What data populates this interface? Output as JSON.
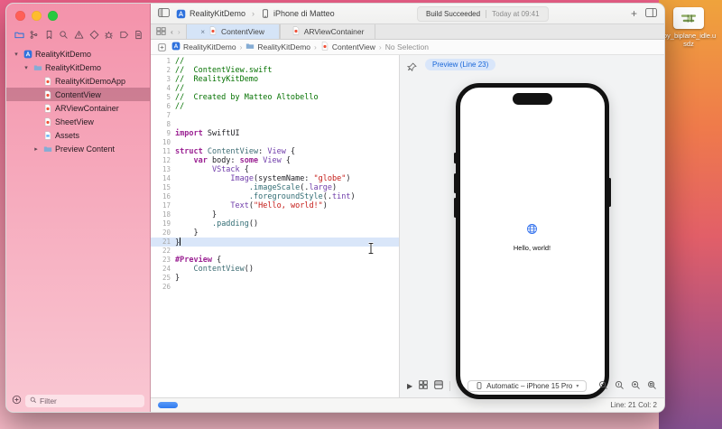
{
  "desktop": {
    "file_label": "toy_biplane_idle.usdz"
  },
  "colors": {
    "accent_blue": "#3478f6",
    "swift_orange": "#f05138",
    "string_red": "#c41a16",
    "keyword_pink": "#9b2393",
    "comment_green": "#047101",
    "type_purple": "#703daa"
  },
  "window": {
    "toolbar": {
      "project": "RealityKitDemo",
      "destination": "iPhone di Matteo",
      "status_title": "Build Succeeded",
      "status_time": "Today at 09:41"
    },
    "navigator": {
      "icons": [
        "project-navigator",
        "source-control",
        "bookmarks",
        "find",
        "issues",
        "tests",
        "debug",
        "breakpoints",
        "reports"
      ],
      "tree": [
        {
          "label": "RealityKitDemo",
          "type": "project",
          "level": 0,
          "disclosure": "open"
        },
        {
          "label": "RealityKitDemo",
          "type": "folder",
          "level": 1,
          "disclosure": "open"
        },
        {
          "label": "RealityKitDemoApp",
          "type": "swift",
          "level": 2
        },
        {
          "label": "ContentView",
          "type": "swift",
          "level": 2,
          "selected": true
        },
        {
          "label": "ARViewContainer",
          "type": "swift",
          "level": 2
        },
        {
          "label": "SheetView",
          "type": "swift",
          "level": 2
        },
        {
          "label": "Assets",
          "type": "assets",
          "level": 2
        },
        {
          "label": "Preview Content",
          "type": "folder",
          "level": 2,
          "disclosure": "closed"
        }
      ],
      "filter_placeholder": "Filter"
    },
    "tabs": [
      {
        "label": "ContentView",
        "active": true
      },
      {
        "label": "ARViewContainer",
        "active": false
      }
    ],
    "breadcrumb": [
      {
        "label": "RealityKitDemo",
        "icon": "project"
      },
      {
        "label": "RealityKitDemo",
        "icon": "folder"
      },
      {
        "label": "ContentView",
        "icon": "swift"
      },
      {
        "label": "No Selection",
        "icon": "none"
      }
    ],
    "editor": {
      "current_line": 21,
      "lines": [
        {
          "n": 1,
          "parts": [
            {
              "t": "//",
              "c": "c"
            }
          ]
        },
        {
          "n": 2,
          "parts": [
            {
              "t": "//  ContentView.swift",
              "c": "c"
            }
          ]
        },
        {
          "n": 3,
          "parts": [
            {
              "t": "//  RealityKitDemo",
              "c": "c"
            }
          ]
        },
        {
          "n": 4,
          "parts": [
            {
              "t": "//",
              "c": "c"
            }
          ]
        },
        {
          "n": 5,
          "parts": [
            {
              "t": "//  Created by Matteo Altobello",
              "c": "c"
            }
          ]
        },
        {
          "n": 6,
          "parts": [
            {
              "t": "//",
              "c": "c"
            }
          ]
        },
        {
          "n": 7,
          "parts": []
        },
        {
          "n": 8,
          "parts": []
        },
        {
          "n": 9,
          "parts": [
            {
              "t": "import",
              "c": "kw"
            },
            {
              "t": " SwiftUI",
              "c": "pl"
            }
          ]
        },
        {
          "n": 10,
          "parts": []
        },
        {
          "n": 11,
          "parts": [
            {
              "t": "struct",
              "c": "kw"
            },
            {
              "t": " ContentView",
              "c": "pt"
            },
            {
              "t": ": ",
              "c": "pl"
            },
            {
              "t": "View",
              "c": "ty"
            },
            {
              "t": " {",
              "c": "pl"
            }
          ]
        },
        {
          "n": 12,
          "parts": [
            {
              "t": "    ",
              "c": "pl"
            },
            {
              "t": "var",
              "c": "kw"
            },
            {
              "t": " body: ",
              "c": "pl"
            },
            {
              "t": "some",
              "c": "kw"
            },
            {
              "t": " ",
              "c": "pl"
            },
            {
              "t": "View",
              "c": "ty"
            },
            {
              "t": " {",
              "c": "pl"
            }
          ]
        },
        {
          "n": 13,
          "parts": [
            {
              "t": "        ",
              "c": "pl"
            },
            {
              "t": "VStack",
              "c": "ty"
            },
            {
              "t": " {",
              "c": "pl"
            }
          ]
        },
        {
          "n": 14,
          "parts": [
            {
              "t": "            ",
              "c": "pl"
            },
            {
              "t": "Image",
              "c": "ty"
            },
            {
              "t": "(systemName: ",
              "c": "pl"
            },
            {
              "t": "\"globe\"",
              "c": "st"
            },
            {
              "t": ")",
              "c": "pl"
            }
          ]
        },
        {
          "n": 15,
          "parts": [
            {
              "t": "                ",
              "c": "pl"
            },
            {
              "t": ".imageScale",
              "c": "fn"
            },
            {
              "t": "(.",
              "c": "pl"
            },
            {
              "t": "large",
              "c": "ty"
            },
            {
              "t": ")",
              "c": "pl"
            }
          ]
        },
        {
          "n": 16,
          "parts": [
            {
              "t": "                ",
              "c": "pl"
            },
            {
              "t": ".foregroundStyle",
              "c": "fn"
            },
            {
              "t": "(.",
              "c": "pl"
            },
            {
              "t": "tint",
              "c": "ty"
            },
            {
              "t": ")",
              "c": "pl"
            }
          ]
        },
        {
          "n": 17,
          "parts": [
            {
              "t": "            ",
              "c": "pl"
            },
            {
              "t": "Text",
              "c": "ty"
            },
            {
              "t": "(",
              "c": "pl"
            },
            {
              "t": "\"Hello, world!\"",
              "c": "st"
            },
            {
              "t": ")",
              "c": "pl"
            }
          ]
        },
        {
          "n": 18,
          "parts": [
            {
              "t": "        }",
              "c": "pl"
            }
          ]
        },
        {
          "n": 19,
          "parts": [
            {
              "t": "        ",
              "c": "pl"
            },
            {
              "t": ".padding",
              "c": "fn"
            },
            {
              "t": "()",
              "c": "pl"
            }
          ]
        },
        {
          "n": 20,
          "parts": [
            {
              "t": "    }",
              "c": "pl"
            }
          ]
        },
        {
          "n": 21,
          "parts": [
            {
              "t": "}",
              "c": "pl"
            }
          ]
        },
        {
          "n": 22,
          "parts": []
        },
        {
          "n": 23,
          "parts": [
            {
              "t": "#Preview",
              "c": "kw"
            },
            {
              "t": " {",
              "c": "pl"
            }
          ]
        },
        {
          "n": 24,
          "parts": [
            {
              "t": "    ",
              "c": "pl"
            },
            {
              "t": "ContentView",
              "c": "pt"
            },
            {
              "t": "()",
              "c": "pl"
            }
          ]
        },
        {
          "n": 25,
          "parts": [
            {
              "t": "}",
              "c": "pl"
            }
          ]
        },
        {
          "n": 26,
          "parts": []
        }
      ]
    },
    "canvas": {
      "badge": "Preview (Line 23)",
      "device": "Automatic – iPhone 15 Pro",
      "phone_text": "Hello, world!"
    },
    "statusbar": {
      "caret": "Line: 21 Col: 2"
    }
  }
}
